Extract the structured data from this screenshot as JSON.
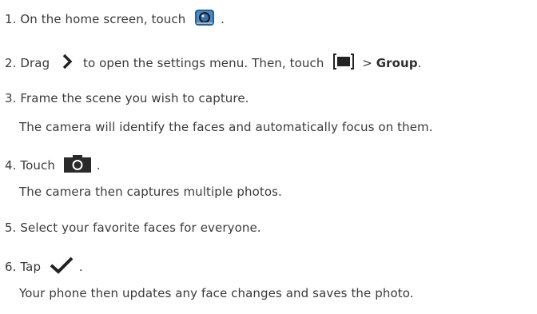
{
  "steps": [
    {
      "num": "1.",
      "text_before": "On the home screen, touch",
      "text_after": "."
    },
    {
      "num": "2.",
      "text_before": "Drag",
      "text_mid": "to open the settings menu. Then, touch",
      "sep": ">",
      "bold": "Group",
      "text_after": "."
    },
    {
      "num": "3.",
      "text": "Frame the scene you wish to capture."
    },
    {
      "num": "4.",
      "text_before": "Touch",
      "text_after": "."
    },
    {
      "num": "5.",
      "text": "Select your favorite faces for everyone."
    },
    {
      "num": "6.",
      "text_before": "Tap",
      "text_after": "."
    }
  ],
  "notes": {
    "step3": "The camera will identify the faces and automatically focus on them.",
    "step4": "The camera then captures multiple photos.",
    "step6": "Your phone then updates any face changes and saves the photo."
  },
  "icons": {
    "camera_app": "camera-app-icon",
    "chevron": "chevron-right-icon",
    "group_mode": "group-mode-icon",
    "shutter": "camera-shutter-icon",
    "check": "checkmark-icon"
  }
}
